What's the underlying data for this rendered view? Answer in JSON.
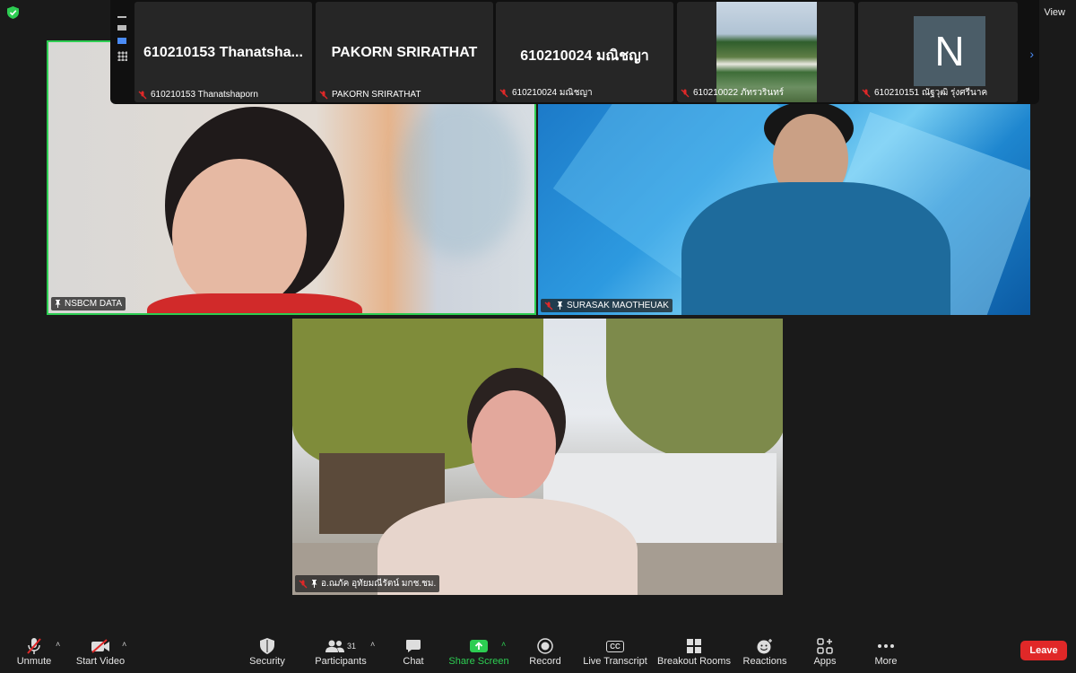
{
  "top_right": {
    "view_label": "View"
  },
  "strip": {
    "tiles": [
      {
        "big": "610210153 Thanatsha...",
        "caption": "610210153 Thanatshaporn"
      },
      {
        "big": "PAKORN SRIRATHAT",
        "caption": "PAKORN SRIRATHAT"
      },
      {
        "big": "610210024 มณิชญา",
        "caption": "610210024 มณิชญา"
      },
      {
        "caption": "610210022 ภัทรวรินทร์"
      },
      {
        "avatar_letter": "N",
        "caption": "610210151 ณัฐวุฒิ รุ่งศรีนาค"
      }
    ]
  },
  "videos": [
    {
      "label": "NSBCM DATA"
    },
    {
      "label": "SURASAK MAOTHEUAK"
    },
    {
      "label": "อ.ณภัค อุทัยมณีรัตน์ มกช.ชม."
    }
  ],
  "toolbar": {
    "unmute": "Unmute",
    "start_video": "Start Video",
    "security": "Security",
    "participants": "Participants",
    "participants_count": "31",
    "chat": "Chat",
    "share_screen": "Share Screen",
    "record": "Record",
    "live_transcript": "Live Transcript",
    "cc_badge": "CC",
    "breakout_rooms": "Breakout Rooms",
    "reactions": "Reactions",
    "apps": "Apps",
    "more": "More",
    "leave": "Leave"
  },
  "colors": {
    "accent_green": "#2dcd52",
    "leave_red": "#e02828",
    "active_blue": "#4a8bf5"
  }
}
